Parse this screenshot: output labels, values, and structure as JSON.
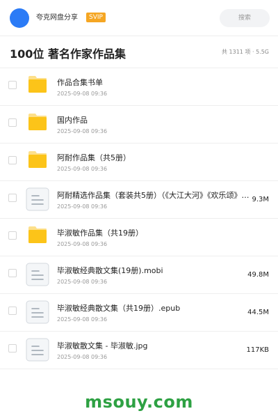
{
  "header": {
    "share_title": "夸克网盘分享",
    "badge": "SVIP",
    "search_placeholder": "搜索"
  },
  "folder": {
    "title": "100位 著名作家作品集",
    "summary": "共 1311 项 · 5.5G"
  },
  "files": [
    {
      "type": "folder",
      "name": "作品合集书单",
      "date": "2025-09-08 09:36",
      "size": ""
    },
    {
      "type": "folder",
      "name": "国内作品",
      "date": "2025-09-08 09:36",
      "size": ""
    },
    {
      "type": "folder",
      "name": "阿耐作品集（共5册）",
      "date": "2025-09-08 09:36",
      "size": ""
    },
    {
      "type": "file",
      "name": "阿耐精选作品集（套装共5册）（《大江大河》《欢乐颂》…",
      "date": "2025-09-08 09:36",
      "size": "9.3M"
    },
    {
      "type": "folder",
      "name": "毕淑敏作品集（共19册）",
      "date": "2025-09-08 09:36",
      "size": ""
    },
    {
      "type": "file",
      "name": "毕淑敏经典散文集(19册).mobi",
      "date": "2025-09-08 09:36",
      "size": "49.8M"
    },
    {
      "type": "file",
      "name": "毕淑敏经典散文集（共19册）.epub",
      "date": "2025-09-08 09:36",
      "size": "44.5M"
    },
    {
      "type": "file",
      "name": "毕淑敏散文集 - 毕淑敏.jpg",
      "date": "2025-09-08 09:36",
      "size": "117KB"
    }
  ],
  "icons": {
    "folder": "folder-icon",
    "file": "document-icon"
  },
  "colors": {
    "avatar": "#2b7bf6",
    "badge": "#f5a623",
    "folder": "#fcc419",
    "watermark": "#2ea143"
  },
  "watermark": "msouy.com"
}
